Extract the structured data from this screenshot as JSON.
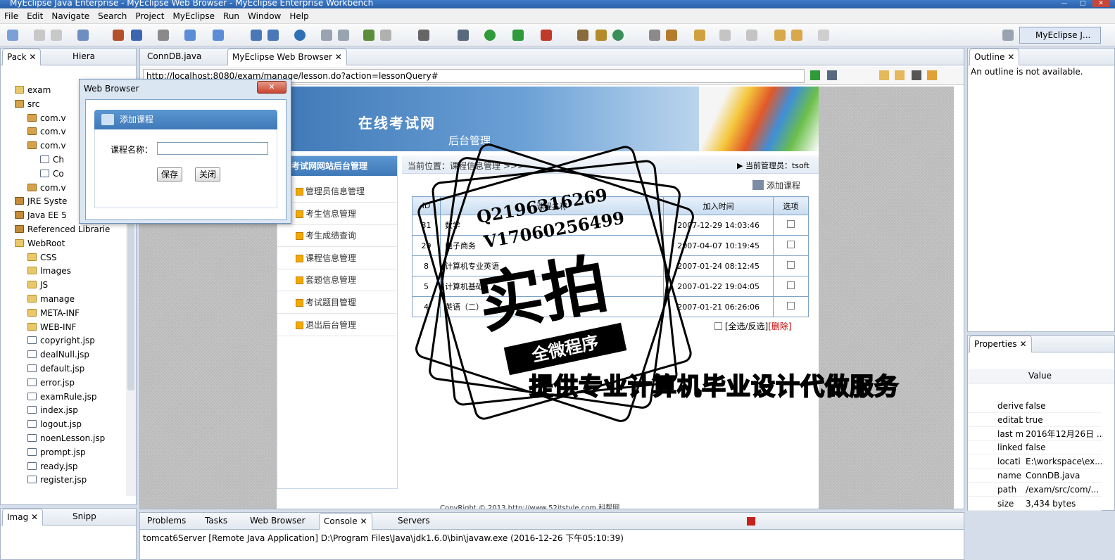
{
  "window": {
    "title": "MyEclipse Java Enterprise - MyEclipse Web Browser - MyEclipse Enterprise Workbench"
  },
  "menu": [
    "File",
    "Edit",
    "Navigate",
    "Search",
    "Project",
    "MyEclipse",
    "Run",
    "Window",
    "Help"
  ],
  "perspective": "MyEclipse J...",
  "left_panel": {
    "tabs": [
      "Pack",
      "Hiera"
    ],
    "tree": [
      {
        "label": "exam",
        "icon": "project-icon"
      },
      {
        "label": "src",
        "icon": "package-folder-icon"
      },
      {
        "label": "com.v",
        "icon": "package-icon"
      },
      {
        "label": "com.v",
        "icon": "package-icon"
      },
      {
        "label": "com.v",
        "icon": "package-icon"
      },
      {
        "label": "Ch",
        "icon": "java-file-icon"
      },
      {
        "label": "Co",
        "icon": "java-file-icon"
      },
      {
        "label": "com.v",
        "icon": "package-icon"
      },
      {
        "label": "JRE Syste",
        "icon": "library-icon"
      },
      {
        "label": "Java EE 5",
        "icon": "library-icon"
      },
      {
        "label": "Referenced Librarie",
        "icon": "library-icon"
      },
      {
        "label": "WebRoot",
        "icon": "folder-icon"
      },
      {
        "label": "CSS",
        "icon": "folder-icon"
      },
      {
        "label": "Images",
        "icon": "folder-icon"
      },
      {
        "label": "JS",
        "icon": "folder-icon"
      },
      {
        "label": "manage",
        "icon": "folder-icon"
      },
      {
        "label": "META-INF",
        "icon": "folder-icon"
      },
      {
        "label": "WEB-INF",
        "icon": "folder-icon"
      },
      {
        "label": "copyright.jsp",
        "icon": "jsp-file-icon"
      },
      {
        "label": "dealNull.jsp",
        "icon": "jsp-file-icon"
      },
      {
        "label": "default.jsp",
        "icon": "jsp-file-icon"
      },
      {
        "label": "error.jsp",
        "icon": "jsp-file-icon"
      },
      {
        "label": "examRule.jsp",
        "icon": "jsp-file-icon"
      },
      {
        "label": "index.jsp",
        "icon": "jsp-file-icon"
      },
      {
        "label": "logout.jsp",
        "icon": "jsp-file-icon"
      },
      {
        "label": "noenLesson.jsp",
        "icon": "jsp-file-icon"
      },
      {
        "label": "prompt.jsp",
        "icon": "jsp-file-icon"
      },
      {
        "label": "ready.jsp",
        "icon": "jsp-file-icon"
      },
      {
        "label": "register.jsp",
        "icon": "jsp-file-icon"
      }
    ]
  },
  "bottom_left": {
    "tabs": [
      "Imag",
      "Snipp"
    ]
  },
  "editor": {
    "tabs": [
      "ConnDB.java",
      "MyEclipse Web Browser"
    ],
    "url": "http://localhost:8080/exam/manage/lesson.do?action=lessonQuery#"
  },
  "site": {
    "banner_title": "在线考试网",
    "banner_sub": "后台管理",
    "nav_header": "考试网网站后台管理",
    "nav": [
      "管理员信息管理",
      "考生信息管理",
      "考生成绩查询",
      "课程信息管理",
      "套题信息管理",
      "考试题目管理",
      "退出后台管理"
    ],
    "location": "当前位置：课程信息管理 >>>",
    "admin": "当前管理员：tsoft",
    "add_link": "添加课程",
    "table": {
      "headers": [
        "ID",
        "课程名称",
        "加入时间",
        "选项"
      ],
      "rows": [
        {
          "id": "31",
          "name": "数学",
          "time": "2007-12-29 14:03:46"
        },
        {
          "id": "29",
          "name": "电子商务",
          "time": "2007-04-07 10:19:45"
        },
        {
          "id": "8",
          "name": "计算机专业英语",
          "time": "2007-01-24 08:12:45"
        },
        {
          "id": "5",
          "name": "计算机基础",
          "time": "2007-01-22 19:04:05"
        },
        {
          "id": "4",
          "name": "英语（二）",
          "time": "2007-01-21 06:26:06"
        }
      ]
    },
    "select_all": "[全选/反选]",
    "delete": "[删除]",
    "copyright": "CopyRight © 2013 http://www.52itstyle.com 科帮网"
  },
  "dialog": {
    "window_title": "Web Browser",
    "header": "添加课程",
    "field_label": "课程名称：",
    "field_value": "",
    "save": "保存",
    "close": "关闭"
  },
  "outline": {
    "title": "Outline",
    "message": "An outline is not available."
  },
  "properties": {
    "title": "Properties",
    "value_header": "Value",
    "rows": [
      {
        "k": "derive",
        "v": "false"
      },
      {
        "k": "editab",
        "v": "true"
      },
      {
        "k": "last m",
        "v": "2016年12月26日 ..."
      },
      {
        "k": "linked",
        "v": "false"
      },
      {
        "k": "locati",
        "v": "E:\\workspace\\ex..."
      },
      {
        "k": "name",
        "v": "ConnDB.java"
      },
      {
        "k": "path",
        "v": "/exam/src/com/..."
      },
      {
        "k": "size",
        "v": "3,434  bytes"
      }
    ]
  },
  "console": {
    "tabs": [
      "Problems",
      "Tasks",
      "Web Browser",
      "Console",
      "Servers"
    ],
    "line": "tomcat6Server [Remote Java Application] D:\\Program Files\\Java\\jdk1.6.0\\bin\\javaw.exe (2016-12-26 下午05:10:39)"
  },
  "watermark": {
    "contact1": "Q2196316269",
    "contact2": "V17060256499",
    "big": "实拍",
    "badge": "全微程序",
    "slogan": "提供专业计算机毕业设计代做服务"
  }
}
